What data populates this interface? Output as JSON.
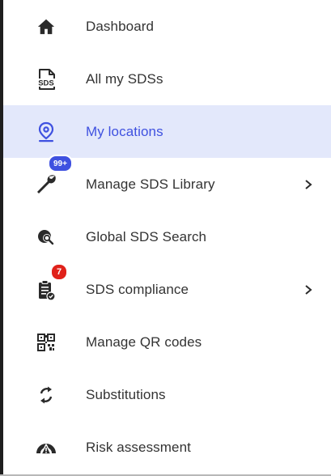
{
  "nav": {
    "items": [
      {
        "label": "Dashboard",
        "icon": "home-icon"
      },
      {
        "label": "All my SDSs",
        "icon": "sds-document-icon"
      },
      {
        "label": "My locations",
        "icon": "location-pin-icon",
        "active": true
      },
      {
        "label": "Manage SDS Library",
        "icon": "wrench-icon",
        "badge": "99+",
        "has_submenu": true
      },
      {
        "label": "Global SDS Search",
        "icon": "globe-search-icon"
      },
      {
        "label": "SDS compliance",
        "icon": "clipboard-check-icon",
        "badge": "7",
        "has_submenu": true
      },
      {
        "label": "Manage QR codes",
        "icon": "qr-code-icon"
      },
      {
        "label": "Substitutions",
        "icon": "substitution-arrows-icon"
      },
      {
        "label": "Risk assessment",
        "icon": "risk-gauge-icon"
      }
    ]
  },
  "colors": {
    "accent": "#3f51e0",
    "active_bg": "#e3e8fb",
    "text": "#333333",
    "badge_red": "#e0211a"
  }
}
